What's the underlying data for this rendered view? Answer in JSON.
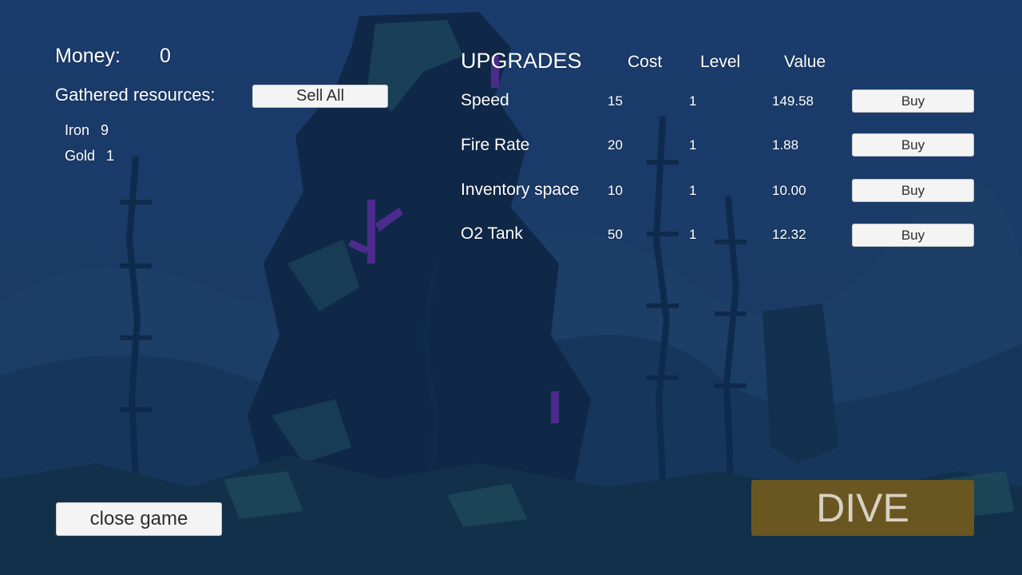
{
  "hud": {
    "money_label": "Money:",
    "money_value": "0",
    "gathered_label": "Gathered resources:",
    "sell_all_label": "Sell All",
    "resources": [
      {
        "name": "Iron",
        "count": "9"
      },
      {
        "name": "Gold",
        "count": "1"
      }
    ]
  },
  "upgrades": {
    "title": "UPGRADES",
    "columns": {
      "cost": "Cost",
      "level": "Level",
      "value": "Value"
    },
    "buy_label": "Buy",
    "rows": [
      {
        "name": "Speed",
        "cost": "15",
        "level": "1",
        "value": "149.58"
      },
      {
        "name": "Fire Rate",
        "cost": "20",
        "level": "1",
        "value": "1.88"
      },
      {
        "name": "Inventory space",
        "cost": "10",
        "level": "1",
        "value": "10.00"
      },
      {
        "name": "O2 Tank",
        "cost": "50",
        "level": "1",
        "value": "12.32"
      }
    ]
  },
  "actions": {
    "close_game_label": "close game",
    "dive_label": "DIVE"
  },
  "colors": {
    "water_top": "#1a3a6b",
    "water_mid": "#1c3c6a",
    "rock_dark": "#0e2245",
    "seaweed": "#12284e",
    "teal": "#1f4a5a",
    "coral_purple": "#4a2a8a",
    "dive_button": "#6a5620"
  }
}
